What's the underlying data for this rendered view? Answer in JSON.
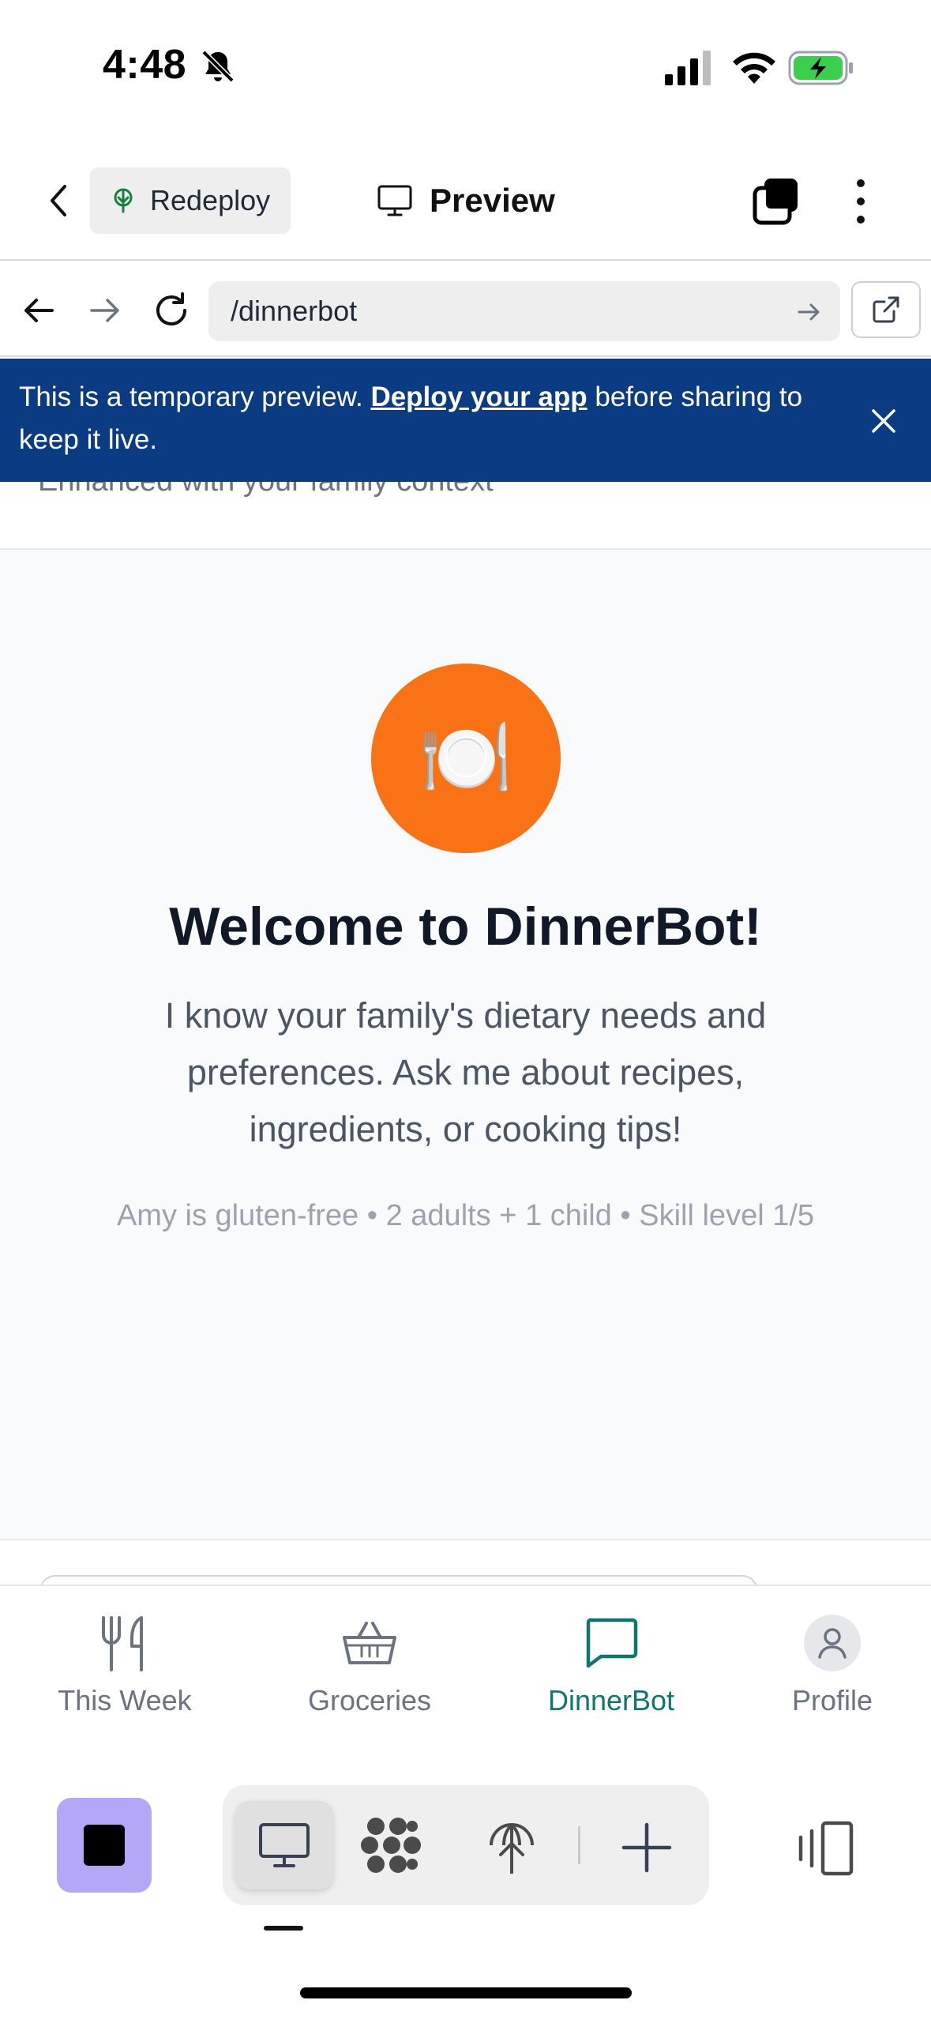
{
  "status_bar": {
    "time": "4:48"
  },
  "header": {
    "redeploy_label": "Redeploy",
    "preview_label": "Preview"
  },
  "url_bar": {
    "url": "/dinnerbot"
  },
  "banner": {
    "text_before": "This is a temporary preview. ",
    "link_text": "Deploy your app",
    "text_after": " before sharing to keep it live."
  },
  "app": {
    "subtitle": "Enhanced with your family context",
    "avatar_emoji": "🍽️",
    "welcome_title": "Welcome to DinnerBot!",
    "intro": "I know your family's dietary needs and preferences. Ask me about recipes, ingredients, or cooking tips!",
    "context_line": "Amy is gluten-free • 2 adults + 1 child • Skill level 1/5"
  },
  "tabs": [
    {
      "label": "This Week",
      "icon": "utensils-icon",
      "active": false
    },
    {
      "label": "Groceries",
      "icon": "basket-icon",
      "active": false
    },
    {
      "label": "DinnerBot",
      "icon": "chat-icon",
      "active": true
    },
    {
      "label": "Profile",
      "icon": "user-icon",
      "active": false
    }
  ],
  "colors": {
    "banner_bg": "#0b3c83",
    "accent_orange": "#f97316",
    "active_tab": "#0f766e",
    "stop_button": "#b4a7f5"
  }
}
